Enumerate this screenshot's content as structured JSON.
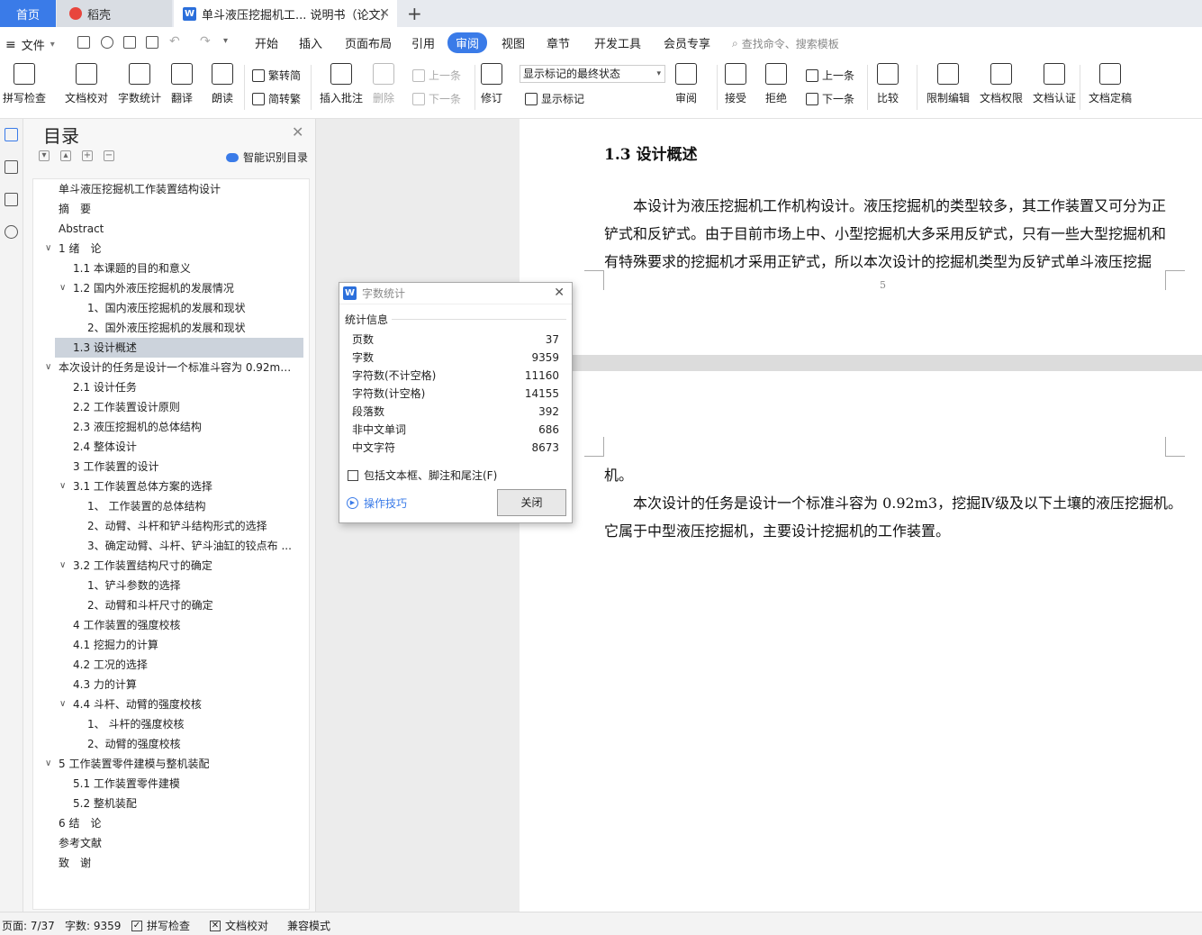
{
  "tabs": {
    "home": "首页",
    "daoke": "稻壳",
    "doc": "单斗液压挖掘机工... 说明书（论文）",
    "new_tab": "+"
  },
  "menu": {
    "file": "文件",
    "items": [
      "开始",
      "插入",
      "页面布局",
      "引用",
      "审阅",
      "视图",
      "章节",
      "开发工具",
      "会员专享"
    ],
    "search_placeholder": "查找命令、搜索模板"
  },
  "ribbon": {
    "spell": "拼写检查",
    "proof": "文档校对",
    "wordcount": "字数统计",
    "translate": "翻译",
    "read": "朗读",
    "trad": "繁转简",
    "simp": "简转繁",
    "insert_comment": "插入批注",
    "delete": "删除",
    "prev1": "上一条",
    "next1": "下一条",
    "revise": "修订",
    "markup_state": "显示标记的最终状态",
    "show_markup": "显示标记",
    "review": "审阅",
    "accept": "接受",
    "reject": "拒绝",
    "prev2": "上一条",
    "next2": "下一条",
    "compare": "比较",
    "restrict": "限制编辑",
    "perms": "文档权限",
    "auth": "文档认证",
    "finalize": "文档定稿"
  },
  "toc": {
    "title": "目录",
    "smart": "智能识别目录",
    "items": [
      {
        "text": "单斗液压挖掘机工作装置结构设计",
        "level": 0,
        "caret": false
      },
      {
        "text": "摘　要",
        "level": 0,
        "caret": false
      },
      {
        "text": "Abstract",
        "level": 0,
        "caret": false
      },
      {
        "text": "1 绪　论",
        "level": 0,
        "caret": true
      },
      {
        "text": "1.1 本课题的目的和意义",
        "level": 1,
        "caret": false
      },
      {
        "text": "1.2 国内外液压挖掘机的发展情况",
        "level": 1,
        "caret": true
      },
      {
        "text": "1、国内液压挖掘机的发展和现状",
        "level": 2,
        "caret": false
      },
      {
        "text": "2、国外液压挖掘机的发展和现状",
        "level": 2,
        "caret": false
      },
      {
        "text": "1.3 设计概述",
        "level": 1,
        "caret": false,
        "selected": true
      },
      {
        "text": "本次设计的任务是设计一个标准斗容为 0.92m3 ...",
        "level": 0,
        "caret": true
      },
      {
        "text": "2.1 设计任务",
        "level": 1,
        "caret": false
      },
      {
        "text": "2.2 工作装置设计原则",
        "level": 1,
        "caret": false
      },
      {
        "text": "2.3 液压挖掘机的总体结构",
        "level": 1,
        "caret": false
      },
      {
        "text": "2.4 整体设计",
        "level": 1,
        "caret": false
      },
      {
        "text": "3 工作装置的设计",
        "level": 1,
        "caret": false
      },
      {
        "text": "3.1  工作装置总体方案的选择",
        "level": 1,
        "caret": true
      },
      {
        "text": "1、  工作装置的总体结构",
        "level": 2,
        "caret": false
      },
      {
        "text": "2、动臂、斗杆和铲斗结构形式的选择",
        "level": 2,
        "caret": false
      },
      {
        "text": "3、确定动臂、斗杆、铲斗油缸的铰点布 ...",
        "level": 2,
        "caret": false
      },
      {
        "text": "3.2 工作装置结构尺寸的确定",
        "level": 1,
        "caret": true
      },
      {
        "text": "1、铲斗参数的选择",
        "level": 2,
        "caret": false
      },
      {
        "text": "2、动臂和斗杆尺寸的确定",
        "level": 2,
        "caret": false
      },
      {
        "text": "4 工作装置的强度校核",
        "level": 1,
        "caret": false
      },
      {
        "text": "4.1 挖掘力的计算",
        "level": 1,
        "caret": false
      },
      {
        "text": "4.2 工况的选择",
        "level": 1,
        "caret": false
      },
      {
        "text": "4.3 力的计算",
        "level": 1,
        "caret": false
      },
      {
        "text": "4.4 斗杆、动臂的强度校核",
        "level": 1,
        "caret": true
      },
      {
        "text": "1、  斗杆的强度校核",
        "level": 2,
        "caret": false
      },
      {
        "text": "2、动臂的强度校核",
        "level": 2,
        "caret": false
      },
      {
        "text": "5 工作装置零件建模与整机装配",
        "level": 0,
        "caret": true
      },
      {
        "text": "5.1 工作装置零件建模",
        "level": 1,
        "caret": false
      },
      {
        "text": "5.2 整机装配",
        "level": 1,
        "caret": false
      },
      {
        "text": "6 结　论",
        "level": 0,
        "caret": false
      },
      {
        "text": "参考文献",
        "level": 0,
        "caret": false
      },
      {
        "text": "致　谢",
        "level": 0,
        "caret": false
      }
    ]
  },
  "doc": {
    "heading": "1.3 设计概述",
    "p1_lines": [
      "本设计为液压挖掘机工作机构设计。液压挖掘机的类型较多，其工作装置又可分为正",
      "铲式和反铲式。由于目前市场上中、小型挖掘机大多采用反铲式，只有一些大型挖掘机和",
      "有特殊要求的挖掘机才采用正铲式，所以本次设计的挖掘机类型为反铲式单斗液压挖掘"
    ],
    "page_number": "5",
    "p1_end": "机。",
    "p2_lines": [
      "本次设计的任务是设计一个标准斗容为 0.92m3，挖掘Ⅳ级及以下土壤的液压挖掘机。",
      "它属于中型液压挖掘机，主要设计挖掘机的工作装置。"
    ]
  },
  "dialog": {
    "title": "字数统计",
    "section": "统计信息",
    "rows": [
      {
        "label": "页数",
        "value": "37"
      },
      {
        "label": "字数",
        "value": "9359"
      },
      {
        "label": "字符数(不计空格)",
        "value": "11160"
      },
      {
        "label": "字符数(计空格)",
        "value": "14155"
      },
      {
        "label": "段落数",
        "value": "392"
      },
      {
        "label": "非中文单词",
        "value": "686"
      },
      {
        "label": "中文字符",
        "value": "8673"
      }
    ],
    "checkbox": "包括文本框、脚注和尾注(F)",
    "tips": "操作技巧",
    "close": "关闭"
  },
  "status": {
    "page": "页面: 7/37",
    "words": "字数: 9359",
    "spell": "拼写检查",
    "proof": "文档校对",
    "compat": "兼容模式"
  },
  "colors": {
    "accent": "#3a7be8",
    "selected": "#ccd3dc",
    "link": "#3a7be8"
  }
}
